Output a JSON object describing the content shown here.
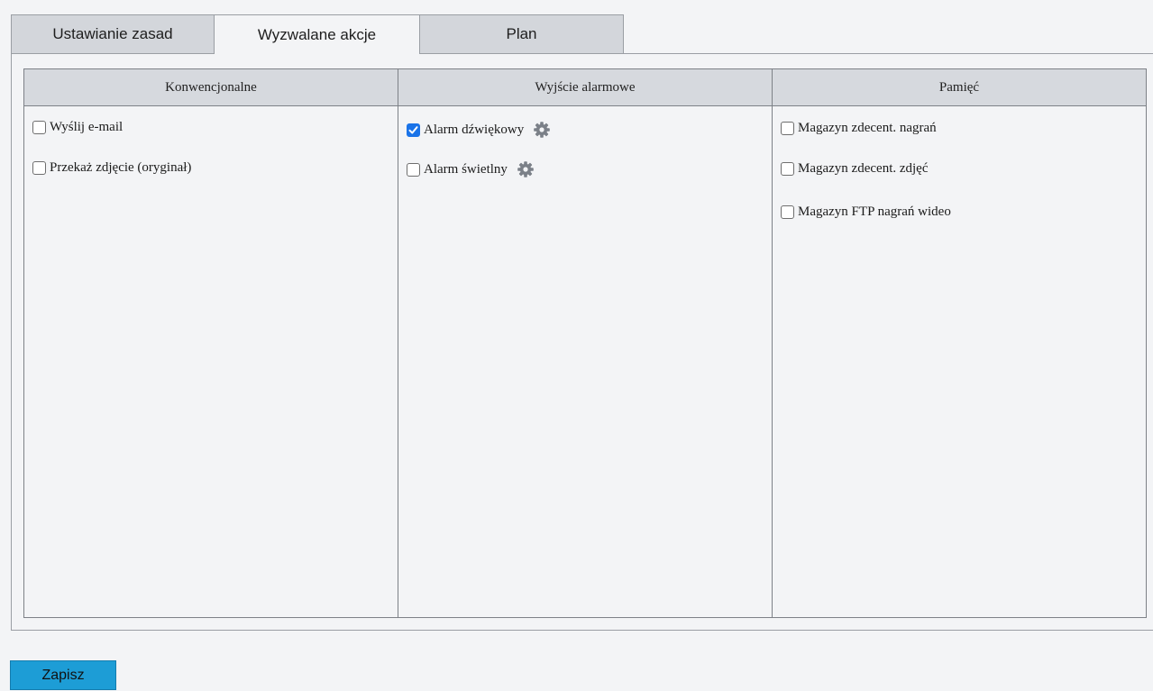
{
  "tabs": [
    {
      "label": "Ustawianie zasad",
      "active": false
    },
    {
      "label": "Wyzwalane akcje",
      "active": true
    },
    {
      "label": "Plan",
      "active": false
    }
  ],
  "columns": [
    {
      "header": "Konwencjonalne",
      "items": [
        {
          "label": "Wyślij e-mail",
          "checked": false,
          "has_settings": false
        },
        {
          "label": "Przekaż zdjęcie (oryginał)",
          "checked": false,
          "has_settings": false
        }
      ]
    },
    {
      "header": "Wyjście alarmowe",
      "items": [
        {
          "label": "Alarm dźwiękowy",
          "checked": true,
          "has_settings": true,
          "settings_icon": "gear-icon"
        },
        {
          "label": "Alarm świetlny",
          "checked": false,
          "has_settings": true,
          "settings_icon": "gear-icon"
        }
      ]
    },
    {
      "header": "Pamięć",
      "items": [
        {
          "label": "Magazyn zdecent. nagrań",
          "checked": false,
          "has_settings": false
        },
        {
          "label": "Magazyn zdecent. zdjęć",
          "checked": false,
          "has_settings": false
        },
        {
          "label": "Magazyn FTP nagrań wideo",
          "checked": false,
          "has_settings": false
        }
      ]
    }
  ],
  "save_button": {
    "label": "Zapisz"
  },
  "colors": {
    "accent": "#1d9dd6",
    "checkbox_checked": "#1a73e8",
    "gear": "#7b8088"
  }
}
